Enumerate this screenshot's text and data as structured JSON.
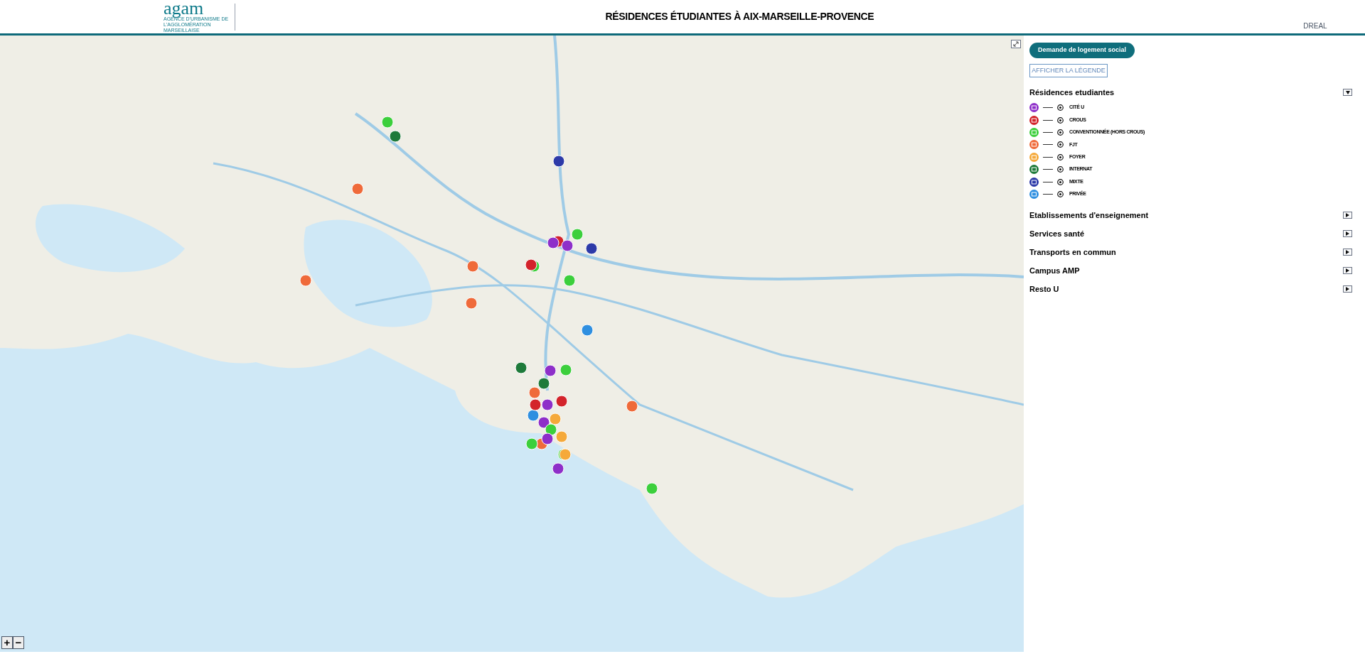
{
  "header": {
    "logo_text": "agam",
    "logo_subtitle": "AGENCE D'URBANISME DE L'AGGLOMÉRATION MARSEILLAISE",
    "title": "RÉSIDENCES ÉTUDIANTES À AIX-MARSEILLE-PROVENCE",
    "partner_logo_text": "DREAL"
  },
  "map": {
    "zoom_in": "+",
    "zoom_out": "−"
  },
  "panel": {
    "primary_button": "Demande de logement social",
    "legend_button": "AFFICHER LA LÉGENDE",
    "layers": [
      {
        "label": "Résidences etudiantes",
        "expanded": true,
        "items": [
          {
            "label": "CITÉ U",
            "color": "#8e2fc9"
          },
          {
            "label": "CROUS",
            "color": "#d3232b"
          },
          {
            "label": "CONVENTIONNÉE (HORS CROUS)",
            "color": "#3ccf3c"
          },
          {
            "label": "FJT",
            "color": "#ef6a3a"
          },
          {
            "label": "FOYER",
            "color": "#f5a93a"
          },
          {
            "label": "INTERNAT",
            "color": "#1e7a3a"
          },
          {
            "label": "MIXTE",
            "color": "#2d3aa8"
          },
          {
            "label": "PRIVÉE",
            "color": "#2f8fe0"
          }
        ]
      },
      {
        "label": "Etablissements d'enseignement",
        "expanded": false
      },
      {
        "label": "Services santé",
        "expanded": false
      },
      {
        "label": "Transports en commun",
        "expanded": false
      },
      {
        "label": "Campus AMP",
        "expanded": false
      },
      {
        "label": "Resto U",
        "expanded": false
      }
    ]
  }
}
